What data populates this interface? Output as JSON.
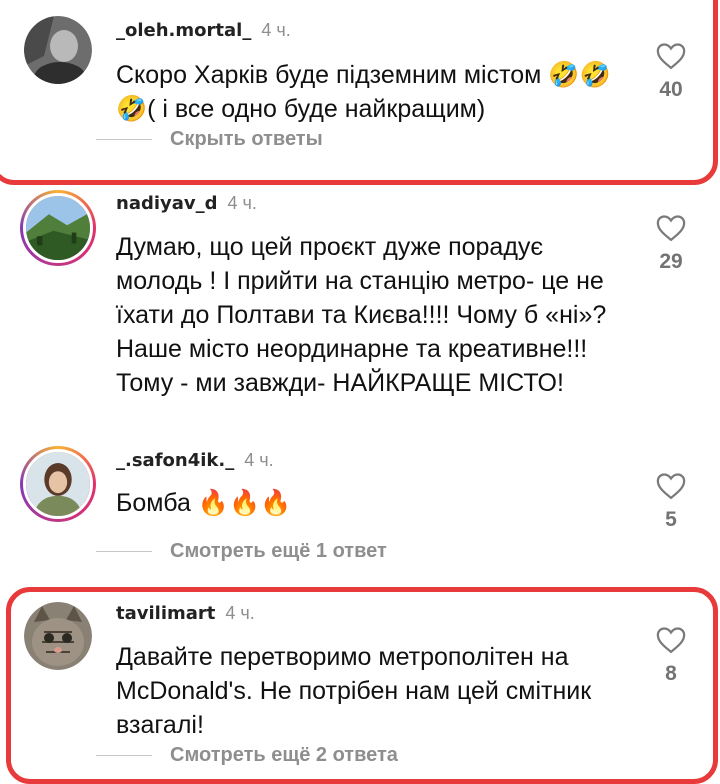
{
  "comments": [
    {
      "username": "_oleh.mortal_",
      "time": "4 ч.",
      "text": "Скоро Харків буде підземним містом 🤣🤣🤣( і все одно буде найкращим)",
      "likes": "40",
      "replies_label": "Скрыть ответы",
      "avatar_icon": "grey-portrait-avatar"
    },
    {
      "username": "nadiyav_d",
      "time": "4 ч.",
      "text": "Думаю, що цей проєкт дуже порадує молодь ! І прийти на станцію метро- це не їхати до Полтави та Києва!!!! Чому б «ні»? Наше місто неординарне та креативне!!! Тому - ми завжди- НАЙКРАЩЕ МІСТО!",
      "likes": "29",
      "avatar_icon": "landscape-avatar"
    },
    {
      "username": "_.safon4ik._",
      "time": "4 ч.",
      "text": "Бомба 🔥🔥🔥",
      "likes": "5",
      "replies_label": "Смотреть ещё 1 ответ",
      "avatar_icon": "woman-portrait-avatar"
    },
    {
      "username": "tavilimart",
      "time": "4 ч.",
      "text": "Давайте перетворимо метрополітен на McDonald's. Не потрібен нам цей смітник взагалі!",
      "likes": "8",
      "replies_label": "Смотреть ещё 2 ответа",
      "avatar_icon": "cat-avatar"
    }
  ],
  "colors": {
    "highlight": "#e83a3a",
    "meta_grey": "#8e8e8e"
  }
}
